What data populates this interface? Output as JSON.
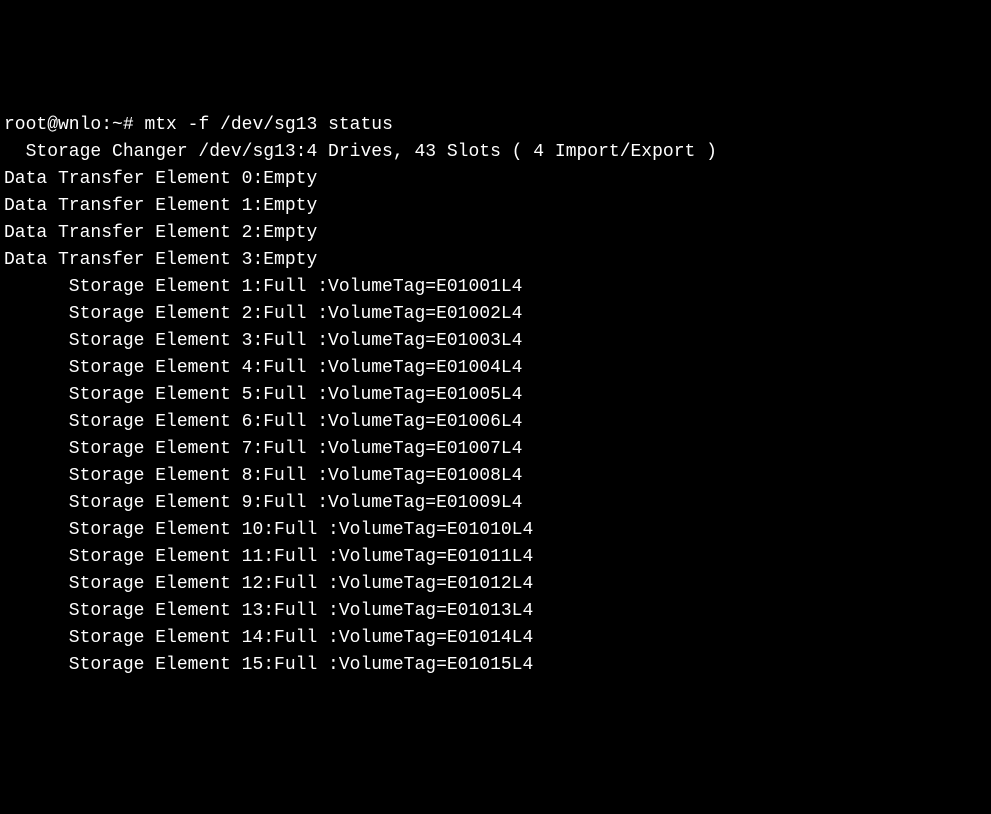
{
  "prompt": "root@wnlo:~# ",
  "command": "mtx -f /dev/sg13 status",
  "header": "  Storage Changer /dev/sg13:4 Drives, 43 Slots ( 4 Import/Export )",
  "dte": [
    "Data Transfer Element 0:Empty",
    "Data Transfer Element 1:Empty",
    "Data Transfer Element 2:Empty",
    "Data Transfer Element 3:Empty"
  ],
  "storage": [
    "      Storage Element 1:Full :VolumeTag=E01001L4",
    "      Storage Element 2:Full :VolumeTag=E01002L4",
    "      Storage Element 3:Full :VolumeTag=E01003L4",
    "      Storage Element 4:Full :VolumeTag=E01004L4",
    "      Storage Element 5:Full :VolumeTag=E01005L4",
    "      Storage Element 6:Full :VolumeTag=E01006L4",
    "      Storage Element 7:Full :VolumeTag=E01007L4",
    "      Storage Element 8:Full :VolumeTag=E01008L4",
    "      Storage Element 9:Full :VolumeTag=E01009L4",
    "      Storage Element 10:Full :VolumeTag=E01010L4",
    "      Storage Element 11:Full :VolumeTag=E01011L4",
    "      Storage Element 12:Full :VolumeTag=E01012L4",
    "      Storage Element 13:Full :VolumeTag=E01013L4",
    "      Storage Element 14:Full :VolumeTag=E01014L4",
    "      Storage Element 15:Full :VolumeTag=E01015L4"
  ]
}
